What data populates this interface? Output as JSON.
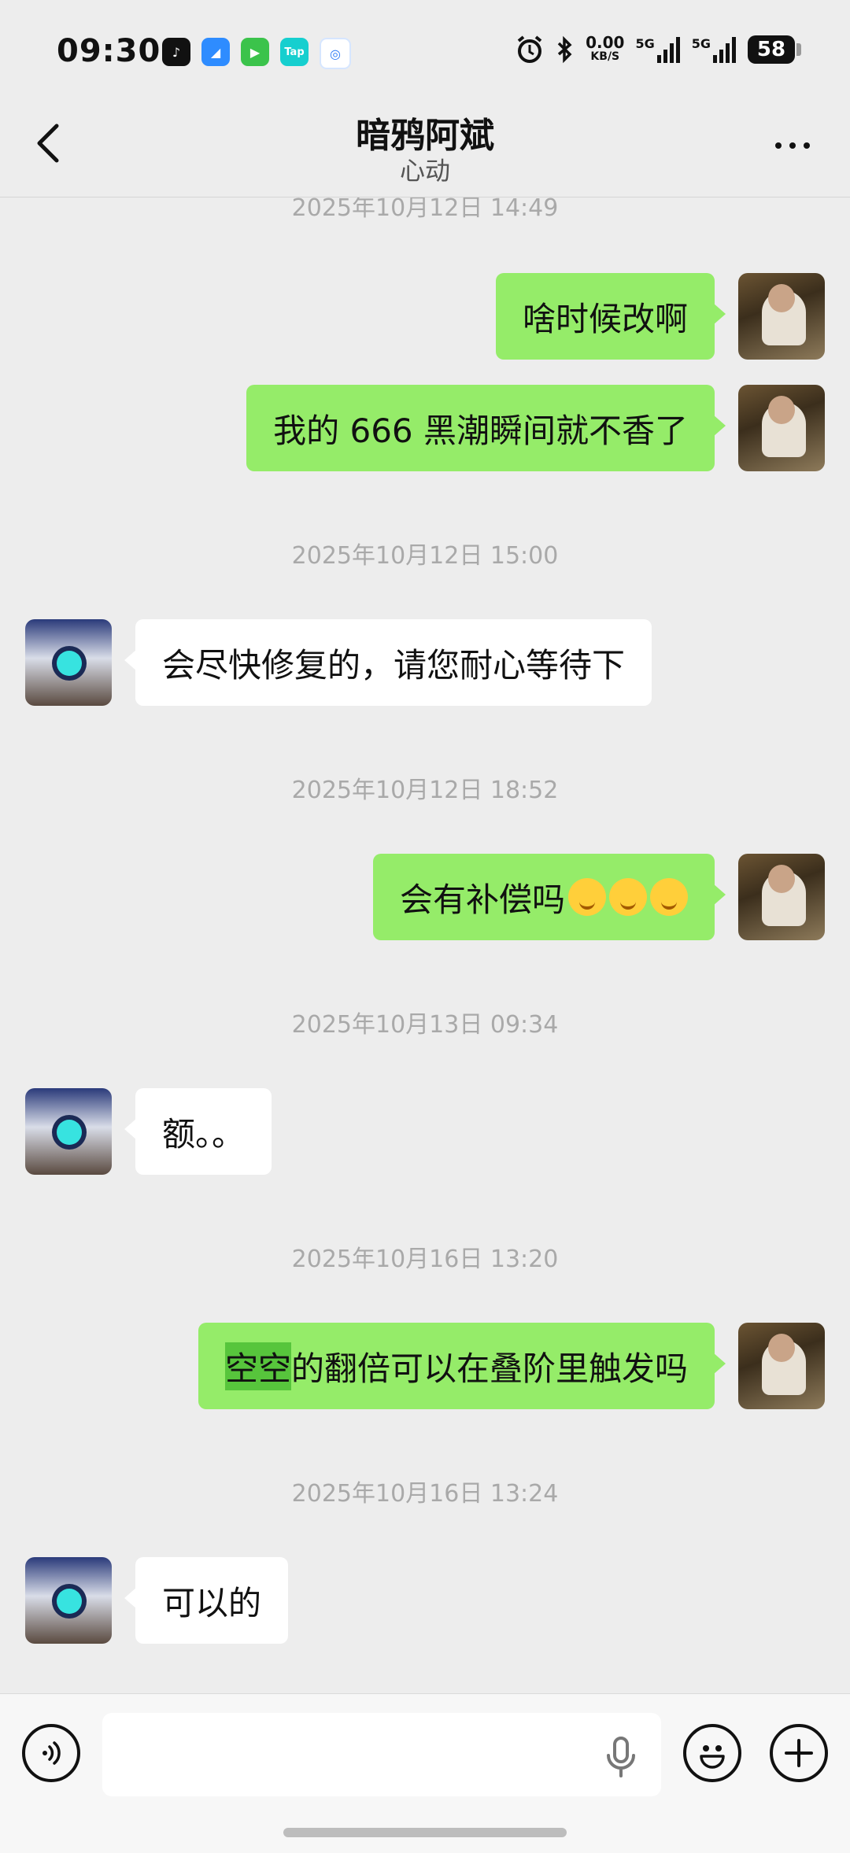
{
  "status_bar": {
    "time": "09:30",
    "net_speed": "0.00",
    "net_unit": "KB/S",
    "sim1": "5G",
    "sim2": "5G",
    "battery": "58"
  },
  "header": {
    "title": "暗鸦阿斌",
    "subtitle": "心动"
  },
  "messages": [
    {
      "type": "timestamp",
      "text": "2025年10月12日 14:49"
    },
    {
      "type": "outgoing",
      "text": "啥时候改啊"
    },
    {
      "type": "outgoing",
      "text": "我的 666 黑潮瞬间就不香了"
    },
    {
      "type": "timestamp",
      "text": "2025年10月12日 15:00"
    },
    {
      "type": "incoming",
      "text": "会尽快修复的，请您耐心等待下"
    },
    {
      "type": "timestamp",
      "text": "2025年10月12日 18:52"
    },
    {
      "type": "outgoing",
      "text": "会有补偿吗",
      "emojis": [
        "smirk-emoji",
        "smirk-emoji",
        "smirk-emoji"
      ]
    },
    {
      "type": "timestamp",
      "text": "2025年10月13日 09:34"
    },
    {
      "type": "incoming",
      "text": "额。。"
    },
    {
      "type": "timestamp",
      "text": "2025年10月16日 13:20"
    },
    {
      "type": "outgoing",
      "highlight": "空空",
      "text": "的翻倍可以在叠阶里触发吗"
    },
    {
      "type": "timestamp",
      "text": "2025年10月16日 13:24"
    },
    {
      "type": "incoming",
      "text": "可以的"
    }
  ],
  "input_bar": {
    "placeholder": "",
    "icons": [
      "voice-icon",
      "microphone-icon",
      "emoji-icon",
      "plus-icon"
    ]
  },
  "colors": {
    "outgoing_bubble": "#95ec69",
    "incoming_bubble": "#ffffff",
    "background": "#ededed",
    "highlight": "#57c53c"
  }
}
